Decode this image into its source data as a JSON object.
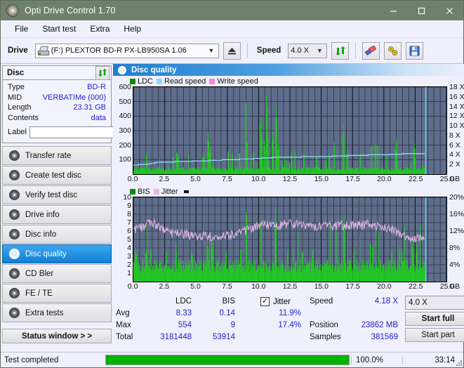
{
  "window": {
    "title": "Opti Drive Control 1.70",
    "icon": "disc-icon",
    "minimize": "minimize-icon",
    "maximize": "maximize-icon",
    "close": "close-icon"
  },
  "menu": {
    "items": [
      "File",
      "Start test",
      "Extra",
      "Help"
    ]
  },
  "toolbar": {
    "drive_label": "Drive",
    "drive_value": "(F:)   PLEXTOR BD-R  PX-LB950SA 1.06",
    "eject_icon": "eject-icon",
    "speed_label": "Speed",
    "speed_value": "4.0 X",
    "refresh_icon": "refresh-icon",
    "erase_icon": "eraser-icon",
    "tools_icon": "tools-icon",
    "save_icon": "save-icon"
  },
  "disc_panel": {
    "title": "Disc",
    "refresh_icon": "refresh-icon",
    "rows": [
      {
        "key": "Type",
        "value": "BD-R"
      },
      {
        "key": "MID",
        "value": "VERBATIMe (000)"
      },
      {
        "key": "Length",
        "value": "23.31 GB"
      },
      {
        "key": "Contents",
        "value": "data"
      }
    ],
    "label_key": "Label",
    "label_value": "",
    "label_button_icon": "cd-icon"
  },
  "sidebar": {
    "items": [
      {
        "label": "Transfer rate",
        "icon": "disc-icon",
        "selected": false
      },
      {
        "label": "Create test disc",
        "icon": "disc-icon",
        "selected": false
      },
      {
        "label": "Verify test disc",
        "icon": "disc-icon",
        "selected": false
      },
      {
        "label": "Drive info",
        "icon": "disc-icon",
        "selected": false
      },
      {
        "label": "Disc info",
        "icon": "disc-icon",
        "selected": false
      },
      {
        "label": "Disc quality",
        "icon": "disc-icon",
        "selected": true
      },
      {
        "label": "CD Bler",
        "icon": "disc-icon",
        "selected": false
      },
      {
        "label": "FE / TE",
        "icon": "disc-icon",
        "selected": false
      },
      {
        "label": "Extra tests",
        "icon": "disc-icon",
        "selected": false
      }
    ],
    "status_window": "Status window > >"
  },
  "panel": {
    "header_title": "Disc quality",
    "header_icon": "disc-icon"
  },
  "stats": {
    "col_headers": [
      "LDC",
      "BIS"
    ],
    "row_labels": [
      "Avg",
      "Max",
      "Total"
    ],
    "ldc": {
      "avg": "8.33",
      "max": "554",
      "total": "3181448"
    },
    "bis": {
      "avg": "0.14",
      "max": "9",
      "total": "53914"
    },
    "jitter_label": "Jitter",
    "jitter_checked": true,
    "jitter_avg": "11.9%",
    "jitter_max": "17.4%",
    "speed_label": "Speed",
    "speed_value": "4.18 X",
    "position_label": "Position",
    "position_value": "23862 MB",
    "samples_label": "Samples",
    "samples_value": "381569",
    "speed_select": "4.0 X",
    "start_full": "Start full",
    "start_part": "Start part"
  },
  "statusbar": {
    "text": "Test completed",
    "percent": "100.0%",
    "progress": 100,
    "time": "33:14"
  },
  "chart_data": [
    {
      "type": "line",
      "name": "ldc-chart",
      "title": "",
      "xlabel": "GB",
      "ylabel": "",
      "x_unit": "GB",
      "xlim": [
        0,
        25.0
      ],
      "ylim": [
        0,
        600
      ],
      "y2lim": [
        0,
        18
      ],
      "y2_unit": "X",
      "grid": true,
      "legend_position": "top-left",
      "xticks": [
        "0.0",
        "2.5",
        "5.0",
        "7.5",
        "10.0",
        "12.5",
        "15.0",
        "17.5",
        "20.0",
        "22.5",
        "25.0"
      ],
      "yticks": [
        100,
        200,
        300,
        400,
        500,
        600
      ],
      "y2ticks": [
        "2 X",
        "4 X",
        "6 X",
        "8 X",
        "10 X",
        "12 X",
        "14 X",
        "16 X",
        "18 X"
      ],
      "series": [
        {
          "name": "LDC",
          "color": "#1db81d",
          "type": "bar",
          "data_end_gb": 23.3,
          "baseline": 40,
          "avg": 8.33,
          "max": 554,
          "peaks": [
            [
              1.05,
              160
            ],
            [
              3.15,
              130
            ],
            [
              3.45,
              165
            ],
            [
              3.55,
              140
            ],
            [
              5.6,
              150
            ],
            [
              5.95,
              290
            ],
            [
              6.1,
              185
            ],
            [
              7.55,
              175
            ],
            [
              7.9,
              150
            ],
            [
              8.45,
              160
            ],
            [
              8.95,
              550
            ],
            [
              9.05,
              245
            ],
            [
              9.55,
              170
            ],
            [
              10.1,
              408
            ],
            [
              10.2,
              300
            ],
            [
              10.45,
              240
            ],
            [
              10.6,
              550
            ],
            [
              10.7,
              300
            ],
            [
              11.1,
              290
            ],
            [
              11.4,
              478
            ],
            [
              11.55,
              210
            ],
            [
              12.6,
              160
            ],
            [
              12.9,
              175
            ],
            [
              13.6,
              155
            ],
            [
              14.6,
              130
            ],
            [
              15.6,
              145
            ],
            [
              16.0,
              230
            ],
            [
              16.75,
              355
            ],
            [
              17.05,
              170
            ],
            [
              18.1,
              150
            ],
            [
              19.0,
              215
            ],
            [
              19.3,
              225
            ],
            [
              19.5,
              220
            ],
            [
              20.9,
              190
            ],
            [
              21.0,
              255
            ],
            [
              22.4,
              220
            ]
          ]
        },
        {
          "name": "Read speed",
          "color": "#8fd8f5",
          "type": "line",
          "points": [
            [
              0.0,
              1.9
            ],
            [
              1.0,
              2.0
            ],
            [
              2.0,
              2.5
            ],
            [
              4.0,
              2.6
            ],
            [
              5.5,
              2.8
            ],
            [
              6.0,
              2.8
            ],
            [
              7.5,
              3.0
            ],
            [
              9.0,
              3.1
            ],
            [
              10.2,
              3.3
            ],
            [
              11.5,
              3.5
            ],
            [
              14.5,
              3.6
            ],
            [
              16.0,
              3.7
            ],
            [
              18.0,
              3.9
            ],
            [
              20.0,
              4.0
            ],
            [
              21.5,
              4.2
            ],
            [
              23.3,
              4.3
            ]
          ]
        },
        {
          "name": "Write speed",
          "color": "#ff7fe0",
          "type": "line",
          "points": []
        }
      ],
      "markers": [
        {
          "type": "vline",
          "x": 23.35,
          "color": "#5fd7f5"
        }
      ]
    },
    {
      "type": "line",
      "name": "bis-chart",
      "title": "",
      "xlabel": "GB",
      "x_unit": "GB",
      "xlim": [
        0,
        25.0
      ],
      "ylim": [
        0,
        10
      ],
      "y2lim": [
        0,
        20
      ],
      "y2_unit": "%",
      "grid": true,
      "legend_position": "top-left",
      "xticks": [
        "0.0",
        "2.5",
        "5.0",
        "7.5",
        "10.0",
        "12.5",
        "15.0",
        "17.5",
        "20.0",
        "22.5",
        "25.0"
      ],
      "yticks": [
        1,
        2,
        3,
        4,
        5,
        6,
        7,
        8,
        9,
        10
      ],
      "y2ticks": [
        "4%",
        "8%",
        "12%",
        "16%",
        "20%"
      ],
      "series": [
        {
          "name": "BIS",
          "color": "#1db81d",
          "type": "bar",
          "data_end_gb": 23.3,
          "baseline": 2.0,
          "avg": 0.14,
          "max": 9,
          "peaks": [
            [
              0.15,
              4.1
            ],
            [
              1.0,
              4.0
            ],
            [
              1.4,
              4.2
            ],
            [
              2.6,
              3.9
            ],
            [
              3.4,
              4.0
            ],
            [
              4.6,
              3.8
            ],
            [
              5.9,
              5.2
            ],
            [
              6.25,
              5.5
            ],
            [
              6.35,
              4.6
            ],
            [
              7.4,
              3.9
            ],
            [
              8.55,
              4.2
            ],
            [
              9.0,
              9.0
            ],
            [
              10.15,
              7.5
            ],
            [
              10.3,
              1.2
            ],
            [
              11.35,
              8.9
            ],
            [
              12.3,
              4.0
            ],
            [
              13.5,
              3.9
            ],
            [
              14.3,
              4.1
            ],
            [
              16.8,
              8.0
            ],
            [
              17.6,
              4.2
            ],
            [
              18.9,
              5.0
            ],
            [
              19.1,
              4.6
            ],
            [
              20.6,
              4.1
            ],
            [
              21.2,
              4.3
            ],
            [
              21.4,
              4.2
            ],
            [
              22.3,
              4.1
            ],
            [
              22.6,
              4.5
            ]
          ]
        },
        {
          "name": "Jitter",
          "color": "#e3b9e3",
          "type": "line",
          "avg_pct": 11.9,
          "max_pct": 17.4,
          "band": [
            [
              0.0,
              12.0
            ],
            [
              1.4,
              13.9
            ],
            [
              3.0,
              11.5
            ],
            [
              5.0,
              11.0
            ],
            [
              6.5,
              10.6
            ],
            [
              8.0,
              11.0
            ],
            [
              9.0,
              12.2
            ],
            [
              10.2,
              13.4
            ],
            [
              11.3,
              13.0
            ],
            [
              12.4,
              14.0
            ],
            [
              14.0,
              12.8
            ],
            [
              16.0,
              13.2
            ],
            [
              17.0,
              13.4
            ],
            [
              19.0,
              13.5
            ],
            [
              20.5,
              12.6
            ],
            [
              22.0,
              10.4
            ],
            [
              23.2,
              10.0
            ]
          ]
        }
      ],
      "markers": [
        {
          "type": "vline",
          "x": 23.35,
          "color": "#5fd7f5"
        }
      ]
    }
  ]
}
